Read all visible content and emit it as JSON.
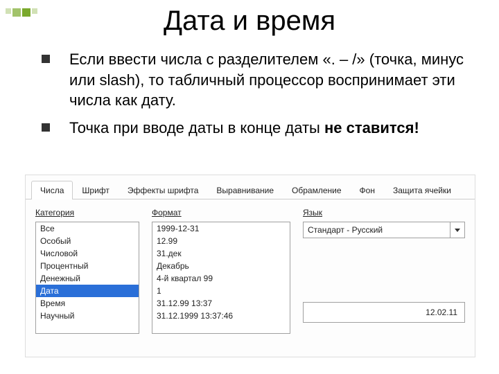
{
  "title": "Дата и время",
  "bullets": [
    "Если ввести числа с разделителем «. – /» (точка, минус или slash), то табличный процессор воспринимает эти числа как дату.",
    "Точка при вводе даты в конце даты <b>не ставится!</b>"
  ],
  "dialog": {
    "tabs": [
      "Числа",
      "Шрифт",
      "Эффекты шрифта",
      "Выравнивание",
      "Обрамление",
      "Фон",
      "Защита ячейки"
    ],
    "active_tab": 0,
    "category_label": "Категория",
    "categories": [
      "Все",
      "Особый",
      "Числовой",
      "Процентный",
      "Денежный",
      "Дата",
      "Время",
      "Научный"
    ],
    "category_selected": 5,
    "format_label": "Формат",
    "formats": [
      "1999-12-31",
      "12.99",
      "31.дек",
      "Декабрь",
      "4-й квартал 99",
      "1",
      "31.12.99 13:37",
      "31.12.1999 13:37:46"
    ],
    "language_label": "Язык",
    "language_value": "Стандарт - Русский",
    "preview_value": "12.02.11"
  }
}
